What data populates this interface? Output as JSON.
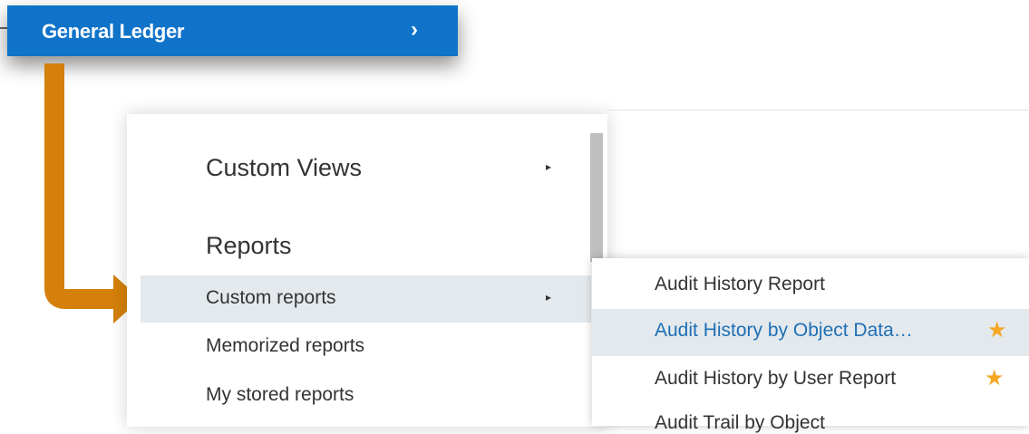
{
  "nav": {
    "general_ledger_label": "General Ledger",
    "chevron": "›"
  },
  "menu": {
    "custom_views_label": "Custom Views",
    "reports_heading": "Reports",
    "items": [
      {
        "label": "Custom reports"
      },
      {
        "label": "Memorized reports"
      },
      {
        "label": "My stored reports"
      }
    ],
    "submenu_arrow": "▸"
  },
  "submenu": {
    "items": [
      {
        "label": "Audit History Report"
      },
      {
        "label": "Audit History by Object Data…"
      },
      {
        "label": "Audit History by User Report"
      },
      {
        "label": "Audit Trail by Object"
      }
    ],
    "star": "★"
  },
  "colors": {
    "accent_blue": "#0f73c9",
    "arrow_orange": "#d4800a",
    "highlight": "#e3e9ed",
    "link_blue": "#1f6fb5",
    "star": "#f5a623"
  }
}
